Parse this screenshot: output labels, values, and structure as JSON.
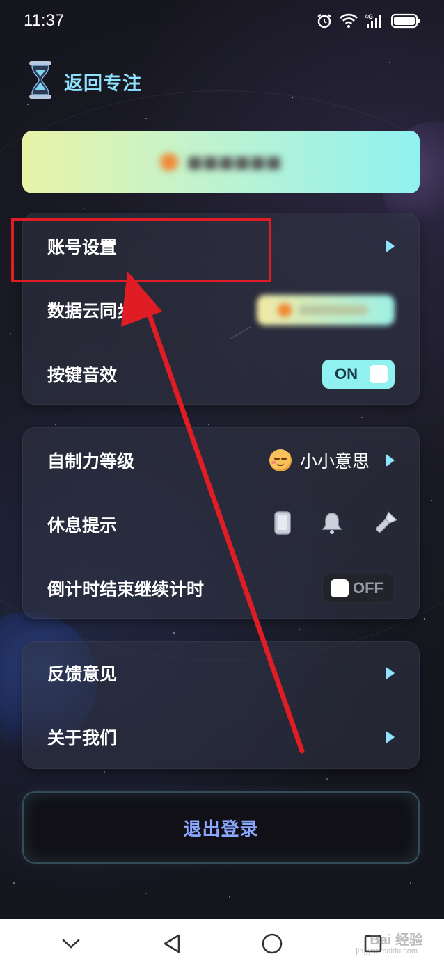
{
  "status_bar": {
    "time": "11:37",
    "icons": [
      "alarm-icon",
      "wifi-icon",
      "4g-signal-icon",
      "battery-icon"
    ],
    "network_label": "4G"
  },
  "header": {
    "icon": "hourglass-icon",
    "title": "返回专注"
  },
  "banner": {
    "icon": "avatar-dot",
    "obscured": true
  },
  "settings_group_1": {
    "rows": [
      {
        "label": "账号设置",
        "control": "chevron"
      },
      {
        "label": "数据云同步",
        "control": "blurred-badge"
      },
      {
        "label": "按键音效",
        "control": "toggle",
        "toggle_text": "ON",
        "state": "on"
      }
    ]
  },
  "settings_group_2": {
    "rows": [
      {
        "label": "自制力等级",
        "value": "小小意思",
        "value_icon": "blushing-face-emoji",
        "control": "chevron"
      },
      {
        "label": "休息提示",
        "icons": [
          "phone-icon",
          "bell-icon",
          "flashlight-icon"
        ]
      },
      {
        "label": "倒计时结束继续计时",
        "control": "toggle",
        "toggle_text": "OFF",
        "state": "off"
      }
    ]
  },
  "settings_group_3": {
    "rows": [
      {
        "label": "反馈意见",
        "control": "chevron"
      },
      {
        "label": "关于我们",
        "control": "chevron"
      }
    ]
  },
  "logout": {
    "label": "退出登录"
  },
  "nav_bar": {
    "icons": [
      "chevron-down-icon",
      "back-triangle-icon",
      "home-circle-icon",
      "recents-square-icon"
    ]
  },
  "watermark": {
    "text": "Bai 经验",
    "sub": "jingyan.baidu.com"
  },
  "colors": {
    "accent": "#8fe3ff",
    "toggle_on": "#8ff2f0",
    "annotation": "#e01d24",
    "logout_text": "#8aa8ff"
  }
}
